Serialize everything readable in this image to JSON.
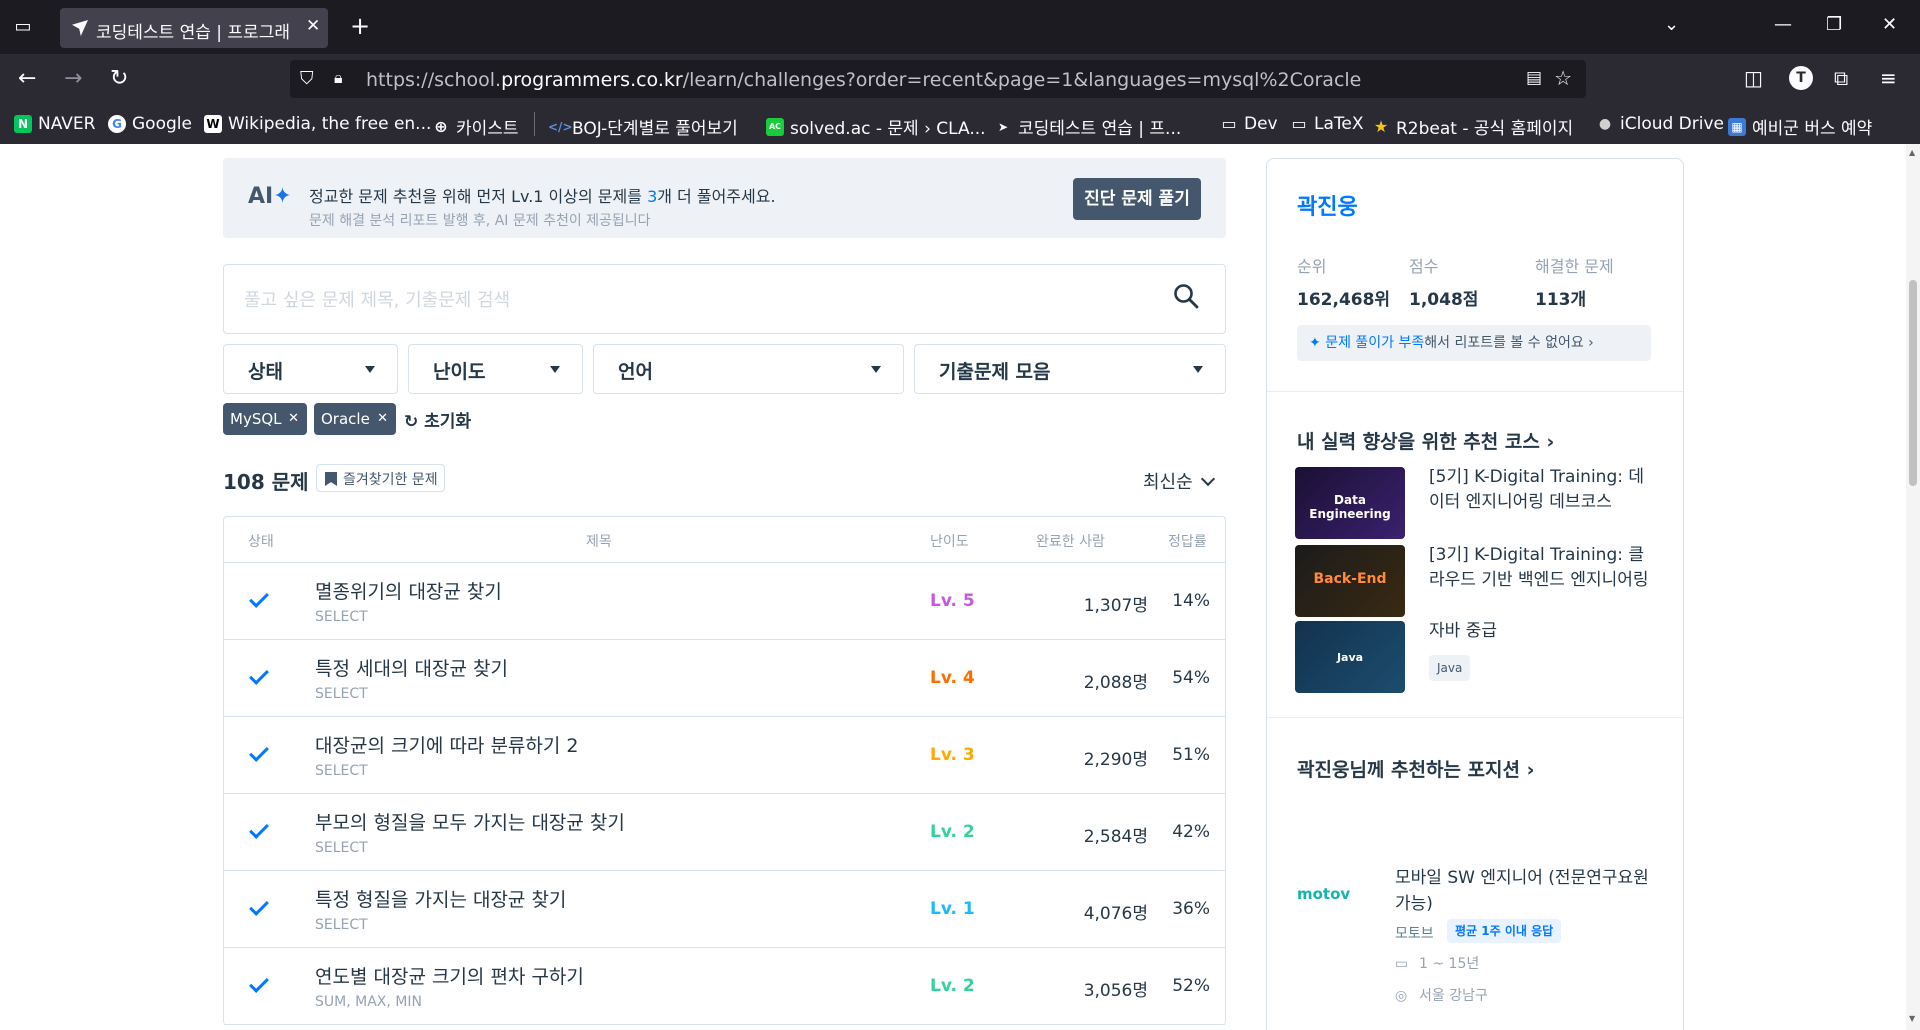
{
  "browser": {
    "tab_title": "코딩테스트 연습 | 프로그래",
    "url_prefix": "https://school.",
    "url_domain": "programmers.co.kr",
    "url_path": "/learn/challenges?order=recent&page=1&languages=mysql%2Coracle",
    "profile_initial": "T",
    "bookmarks": [
      "NAVER",
      "Google",
      "Wikipedia, the free en...",
      "카이스트",
      "BOJ-단계별로 풀어보기",
      "solved.ac - 문제 › CLA...",
      "코딩테스트 연습 | 프...",
      "Dev",
      "LaTeX",
      "R2beat - 공식 홈페이지",
      "iCloud Drive",
      "예비군 버스 예약"
    ]
  },
  "ai_banner": {
    "logo": "AI",
    "message_pre": "정교한 문제 추천을 위해 먼저 Lv.1 이상의 문제를 ",
    "message_count": "3",
    "message_post": "개 더 풀어주세요.",
    "sub": "문제 해결 분석 리포트 발행 후, AI 문제 추천이 제공됩니다",
    "button": "진단 문제 풀기"
  },
  "search": {
    "placeholder": "풀고 싶은 문제 제목, 기출문제 검색"
  },
  "filters": [
    "상태",
    "난이도",
    "언어",
    "기출문제 모음"
  ],
  "chips": [
    "MySQL",
    "Oracle"
  ],
  "reset_label": "초기화",
  "list_header": {
    "count": "108 문제",
    "favorites": "즐겨찾기한 문제",
    "sort": "최신순"
  },
  "table": {
    "columns": [
      "상태",
      "제목",
      "난이도",
      "완료한 사람",
      "정답률"
    ],
    "rows": [
      {
        "title": "멸종위기의 대장균 찾기",
        "part": "SELECT",
        "level": "Lv. 5",
        "level_color": "#c658e1",
        "completed": "1,307명",
        "rate": "14%"
      },
      {
        "title": "특정 세대의 대장균 찾기",
        "part": "SELECT",
        "level": "Lv. 4",
        "level_color": "#ff6d00",
        "completed": "2,088명",
        "rate": "54%"
      },
      {
        "title": "대장균의 크기에 따라 분류하기 2",
        "part": "SELECT",
        "level": "Lv. 3",
        "level_color": "#ffa800",
        "completed": "2,290명",
        "rate": "51%"
      },
      {
        "title": "부모의 형질을 모두 가지는 대장균 찾기",
        "part": "SELECT",
        "level": "Lv. 2",
        "level_color": "#31d29d",
        "completed": "2,584명",
        "rate": "42%"
      },
      {
        "title": "특정 형질을 가지는 대장균 찾기",
        "part": "SELECT",
        "level": "Lv. 1",
        "level_color": "#1bbaff",
        "completed": "4,076명",
        "rate": "36%"
      },
      {
        "title": "연도별 대장균 크기의 편차 구하기",
        "part": "SUM, MAX, MIN",
        "level": "Lv. 2",
        "level_color": "#31d29d",
        "completed": "3,056명",
        "rate": "52%"
      }
    ]
  },
  "profile": {
    "name": "곽진웅",
    "rank_label": "순위",
    "rank": "162,468위",
    "score_label": "점수",
    "score": "1,048점",
    "solved_label": "해결한 문제",
    "solved": "113개",
    "notice_hl": "문제 풀이가 부족",
    "notice_rest": "해서 리포트를 볼 수 없어요"
  },
  "courses": {
    "title": "내 실력 향상을 위한 추천 코스",
    "items": [
      {
        "thumb": "Data Engineering",
        "title": "[5기] K-Digital Training: 데이터 엔지니어링 데브코스",
        "tag": ""
      },
      {
        "thumb": "Back-End",
        "title": "[3기] K-Digital Training: 클라우드 기반 백엔드 엔지니어링",
        "tag": ""
      },
      {
        "thumb": "Java",
        "title": "자바 중급",
        "tag": "Java"
      }
    ]
  },
  "positions": {
    "title": "곽진웅님께 추천하는 포지션",
    "job_title": "모바일 SW 엔지니어 (전문연구요원 가능)",
    "company_logo": "motov",
    "company": "모토브",
    "badge": "평균 1주 이내 응답",
    "experience": "1 ~ 15년",
    "location": "서울 강남구"
  },
  "colors": {
    "accent": "#0078ff",
    "dark_button": "#44576c",
    "border": "#d7e2eb"
  }
}
